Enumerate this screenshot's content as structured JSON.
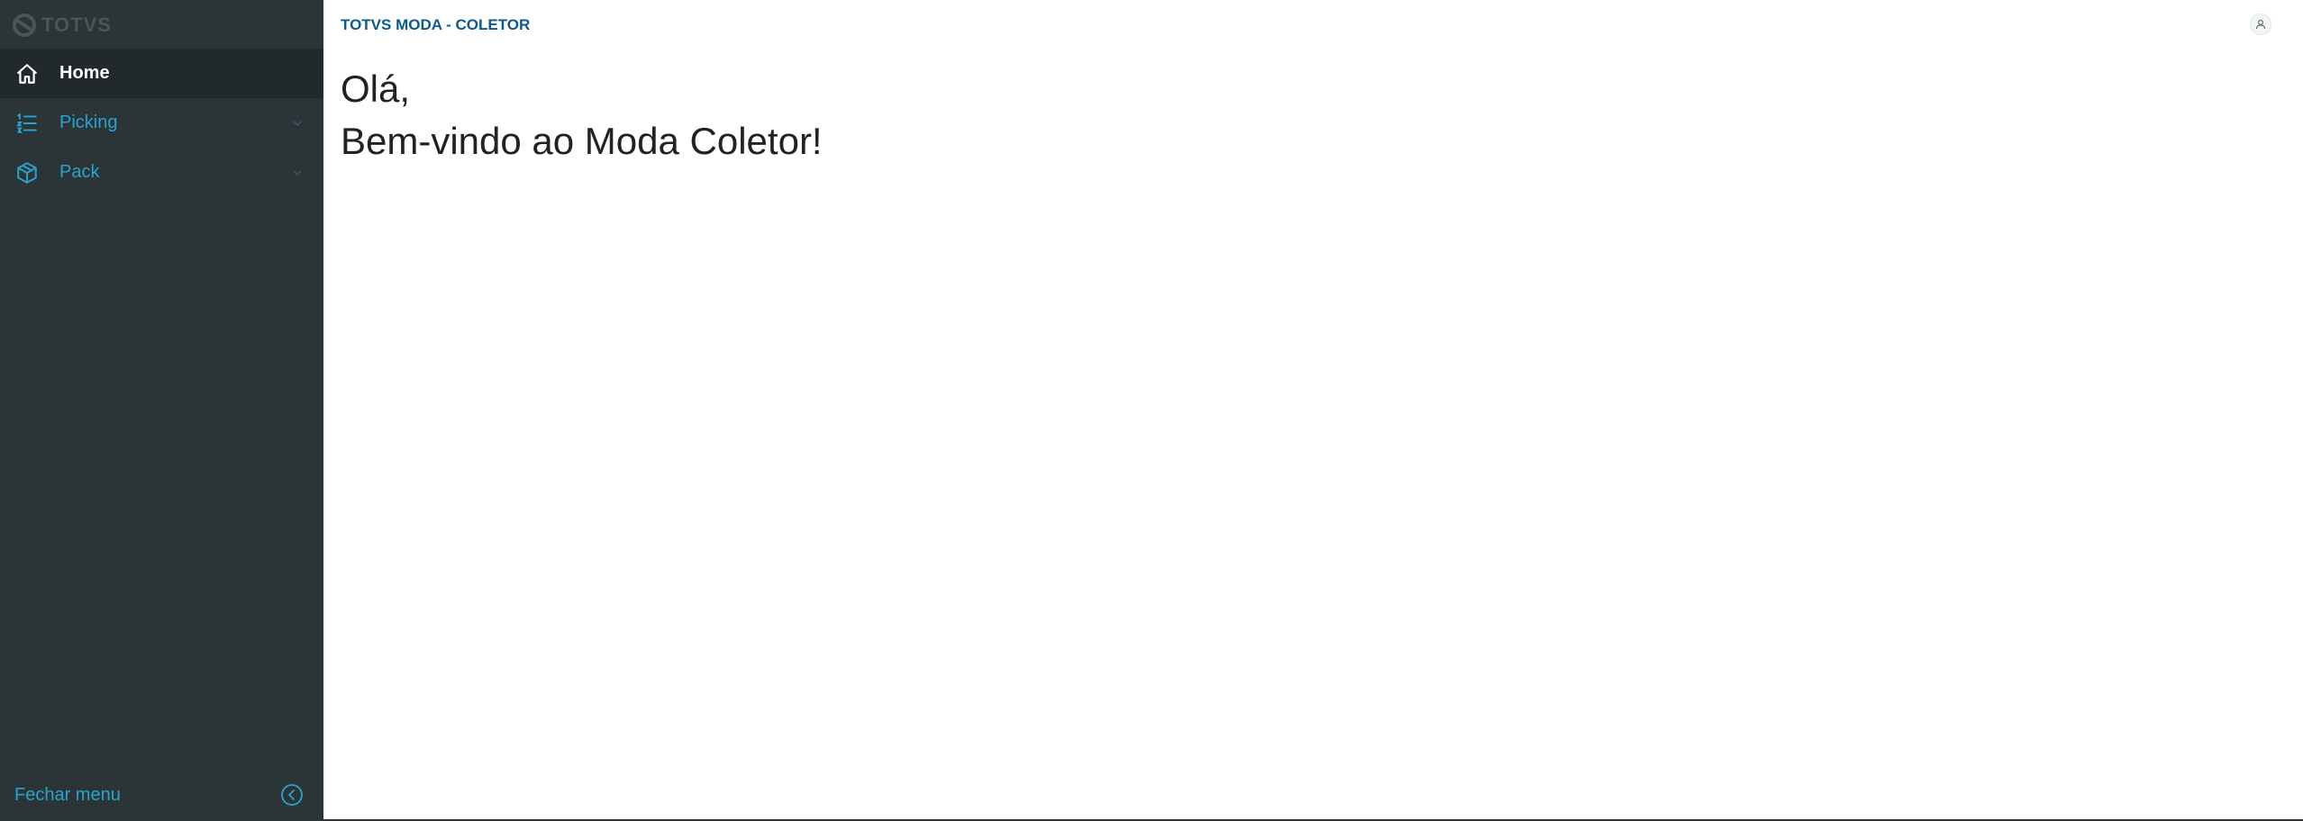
{
  "app": {
    "logo_text": "TOTVS",
    "title": "TOTVS MODA - COLETOR"
  },
  "sidebar": {
    "items": [
      {
        "label": "Home",
        "icon": "home-icon",
        "active": true
      },
      {
        "label": "Picking",
        "icon": "list-icon",
        "active": false
      },
      {
        "label": "Pack",
        "icon": "box-icon",
        "active": false
      }
    ],
    "footer": {
      "close_label": "Fechar menu",
      "close_icon": "chevron-left-circle-icon"
    }
  },
  "main": {
    "greeting": "Olá,",
    "welcome": "Bem-vindo ao Moda Coletor!",
    "user_icon": "user-icon"
  },
  "colors": {
    "sidebar_bg": "#2b3538",
    "active_item_bg": "#22292c",
    "accent": "#29a3cf",
    "header_title": "#0c5a8a"
  }
}
